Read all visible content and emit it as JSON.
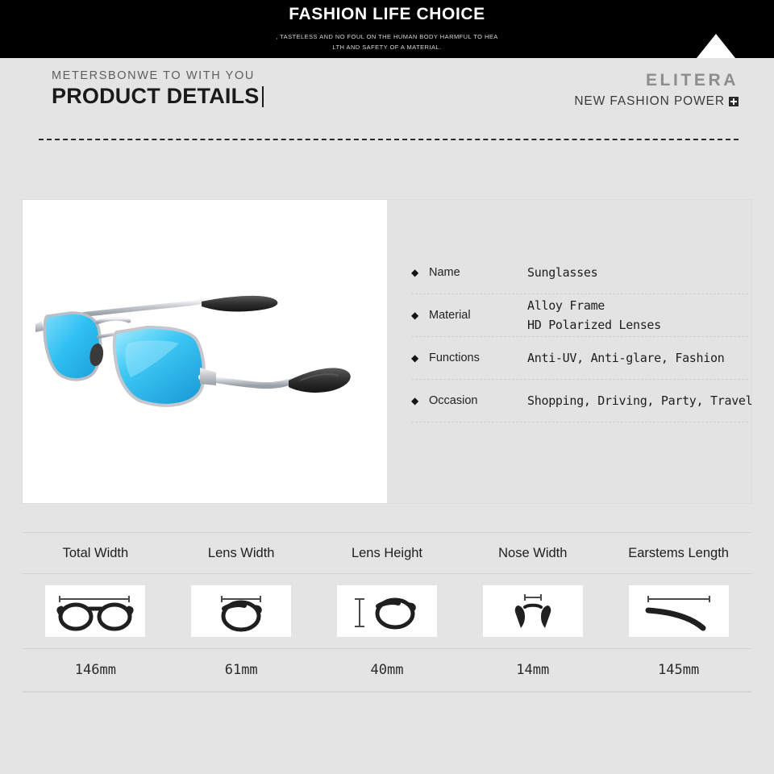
{
  "banner": {
    "title": "FASHION LIFE CHOICE",
    "subtitle_line1": ", TASTELESS AND NO FOUL ON THE HUMAN BODY HARMFUL TO HEA",
    "subtitle_line2": "LTH AND SAFETY OF A MATERIAL.",
    "background": "#000000",
    "triangle_icon": "triangle-up-icon"
  },
  "header": {
    "kicker": "METERSBONWE TO WITH YOU",
    "headline": "PRODUCT DETAILS",
    "brand": "ELITERA",
    "brand_tagline": "NEW FASHION POWER",
    "brand_badge_icon": "plus-badge-icon"
  },
  "product": {
    "image_alt": "sunglasses-product-photo",
    "frame_color": "#c9ccd1",
    "lens_color": "#35c6f4",
    "temple_tip_color": "#3c3c3c"
  },
  "specs": [
    {
      "bullet": "◆",
      "label": "Name",
      "values": [
        "Sunglasses"
      ]
    },
    {
      "bullet": "◆",
      "label": "Material",
      "values": [
        "Alloy Frame",
        "HD Polarized Lenses"
      ]
    },
    {
      "bullet": "◆",
      "label": "Functions",
      "values": [
        "Anti-UV, Anti-glare, Fashion"
      ]
    },
    {
      "bullet": "◆",
      "label": "Occasion",
      "values": [
        "Shopping, Driving, Party, Travel"
      ]
    }
  ],
  "measurements": {
    "headers": [
      "Total Width",
      "Lens Width",
      "Lens Height",
      "Nose Width",
      "Earstems Length"
    ],
    "icons": [
      "total-width-icon",
      "lens-width-icon",
      "lens-height-icon",
      "nose-width-icon",
      "earstems-length-icon"
    ],
    "values": [
      "146",
      "61",
      "40",
      "14",
      "145"
    ],
    "unit": "mm"
  }
}
